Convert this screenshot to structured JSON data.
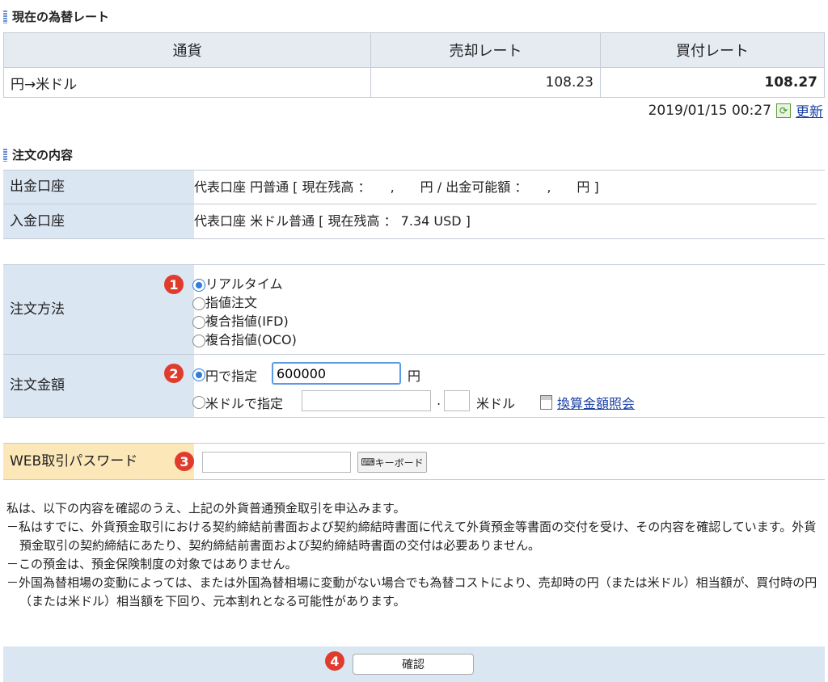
{
  "rate_section": {
    "title": "現在の為替レート",
    "headers": [
      "通貨",
      "売却レート",
      "買付レート"
    ],
    "row": {
      "currency": "円→米ドル",
      "sell": "108.23",
      "buy": "108.27"
    },
    "timestamp": "2019/01/15 00:27",
    "refresh_label": "更新"
  },
  "order_section": {
    "title": "注文の内容",
    "withdraw_label": "出金口座",
    "withdraw_value": "代表口座 円普通 [ 現在残高 ：　　,　　円 / 出金可能額 ：　　,　　円 ]",
    "deposit_label": "入金口座",
    "deposit_value": "代表口座 米ドル普通 [ 現在残高 ： 7.34 USD ]"
  },
  "method": {
    "label": "注文方法",
    "options": [
      "リアルタイム",
      "指値注文",
      "複合指値(IFD)",
      "複合指値(OCO)"
    ],
    "selected": 0
  },
  "amount": {
    "label": "注文金額",
    "yen_option": "円で指定",
    "yen_value": "600000",
    "yen_unit": "円",
    "usd_option": "米ドルで指定",
    "usd_dot": ".",
    "usd_unit": "米ドル",
    "convert_link": "換算金額照会"
  },
  "password": {
    "label": "WEB取引パスワード",
    "keyboard_button": "キーボード"
  },
  "badges": [
    "1",
    "2",
    "3",
    "4"
  ],
  "notice": {
    "intro": "私は、以下の内容を確認のうえ、上記の外貨普通預金取引を申込みます。",
    "items": [
      "－私はすでに、外貨預金取引における契約締結前書面および契約締結時書面に代えて外貨預金等書面の交付を受け、その内容を確認しています。外貨預金取引の契約締結にあたり、契約締結前書面および契約締結時書面の交付は必要ありません。",
      "－この預金は、預金保険制度の対象ではありません。",
      "－外国為替相場の変動によっては、または外国為替相場に変動がない場合でも為替コストにより、売却時の円（または米ドル）相当額が、買付時の円（または米ドル）相当額を下回り、元本割れとなる可能性があります。"
    ]
  },
  "confirm_button": "確認",
  "colors": {
    "label_bg": "#dbe6f3",
    "password_label_bg": "#fbe7b8",
    "badge": "#e03c2e",
    "link": "#1a3fa6",
    "radio": "#2f7cd9"
  }
}
